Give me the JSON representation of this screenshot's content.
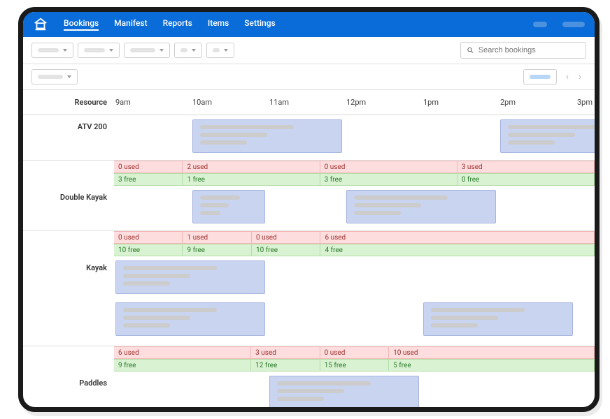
{
  "nav": {
    "items": [
      "Bookings",
      "Manifest",
      "Reports",
      "Items",
      "Settings"
    ],
    "active": "Bookings"
  },
  "search": {
    "placeholder": "Search bookings"
  },
  "grid": {
    "resource_header": "Resource",
    "time_headers": [
      "9am",
      "10am",
      "11am",
      "12pm",
      "1pm",
      "2pm",
      "3pm"
    ],
    "resources": [
      {
        "name": "ATV 200",
        "events": [
          {
            "start": 1,
            "span": 2
          },
          {
            "start": 5,
            "span": 2
          }
        ],
        "used": [
          {
            "start": 0,
            "span": 1,
            "text": "0 used"
          },
          {
            "start": 1,
            "span": 2,
            "text": "2 used"
          },
          {
            "start": 3,
            "span": 2,
            "text": "0 used"
          },
          {
            "start": 5,
            "span": 2,
            "text": "3 used"
          }
        ],
        "free": [
          {
            "start": 0,
            "span": 1,
            "text": "3 free"
          },
          {
            "start": 1,
            "span": 2,
            "text": "1 free"
          },
          {
            "start": 3,
            "span": 2,
            "text": "3 free"
          },
          {
            "start": 5,
            "span": 2,
            "text": "0 free"
          }
        ]
      },
      {
        "name": "Double Kayak",
        "events": [
          {
            "start": 1,
            "span": 1
          },
          {
            "start": 3,
            "span": 2
          }
        ],
        "used": [
          {
            "start": 0,
            "span": 1,
            "text": "0 used"
          },
          {
            "start": 1,
            "span": 1,
            "text": "1 used"
          },
          {
            "start": 2,
            "span": 1,
            "text": "0 used"
          },
          {
            "start": 3,
            "span": 4,
            "text": "6 used"
          }
        ],
        "free": [
          {
            "start": 0,
            "span": 1,
            "text": "10 free"
          },
          {
            "start": 1,
            "span": 1,
            "text": "9 free"
          },
          {
            "start": 2,
            "span": 1,
            "text": "10 free"
          },
          {
            "start": 3,
            "span": 4,
            "text": "4 free"
          }
        ]
      },
      {
        "name": "Kayak",
        "double": true,
        "events": [
          {
            "start": 0,
            "span": 2,
            "row": 0
          },
          {
            "start": 0,
            "span": 2,
            "row": 1
          },
          {
            "start": 4,
            "span": 2,
            "row": 1
          }
        ],
        "used": [
          {
            "start": 0,
            "span": 2,
            "text": "6 used"
          },
          {
            "start": 2,
            "span": 1,
            "text": "3 used"
          },
          {
            "start": 3,
            "span": 1,
            "text": "0 used"
          },
          {
            "start": 4,
            "span": 3,
            "text": "10 used"
          }
        ],
        "free": [
          {
            "start": 0,
            "span": 2,
            "text": "9 free"
          },
          {
            "start": 2,
            "span": 1,
            "text": "12 free"
          },
          {
            "start": 3,
            "span": 1,
            "text": "15 free"
          },
          {
            "start": 4,
            "span": 3,
            "text": "5 free"
          }
        ]
      },
      {
        "name": "Paddles",
        "events": [
          {
            "start": 2,
            "span": 2
          }
        ],
        "used": [],
        "free": []
      }
    ]
  }
}
